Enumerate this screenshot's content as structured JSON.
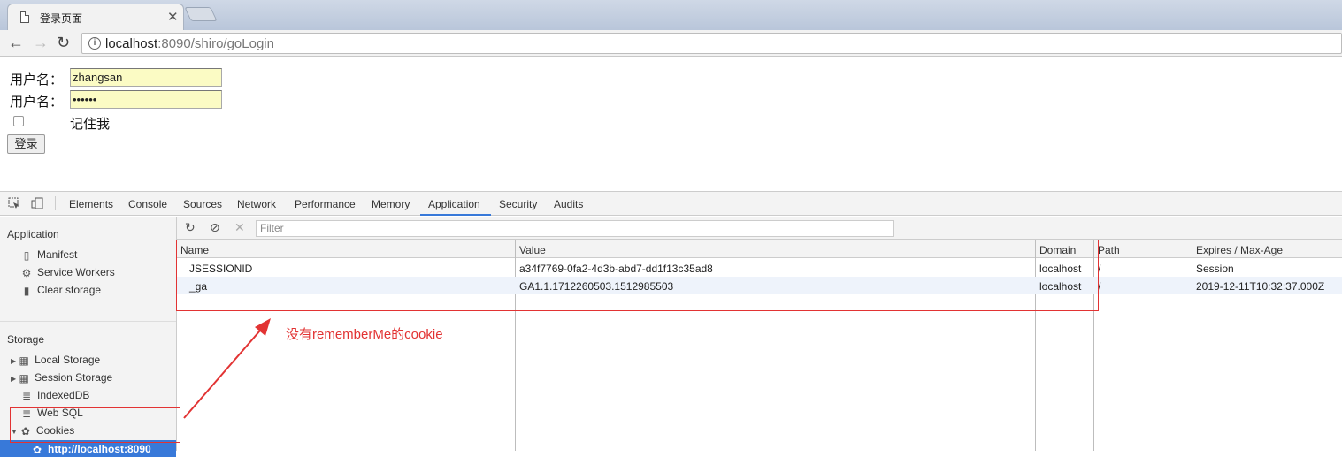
{
  "browser": {
    "tab_title": "登录页面",
    "url_host": "localhost",
    "url_rest": ":8090/shiro/goLogin"
  },
  "form": {
    "username_label": "用户名：",
    "username_value": "zhangsan",
    "password_label": "用户名：",
    "password_value": "••••••",
    "remember_label": "记住我",
    "login_button": "登录"
  },
  "devtools": {
    "tabs": [
      "Elements",
      "Console",
      "Sources",
      "Network",
      "Performance",
      "Memory",
      "Application",
      "Security",
      "Audits"
    ],
    "active_tab": "Application",
    "filter_placeholder": "Filter",
    "sidebar": {
      "application_header": "Application",
      "application_items": [
        "Manifest",
        "Service Workers",
        "Clear storage"
      ],
      "storage_header": "Storage",
      "storage_items": [
        "Local Storage",
        "Session Storage",
        "IndexedDB",
        "Web SQL",
        "Cookies",
        "http://localhost:8090"
      ]
    },
    "columns": [
      "Name",
      "Value",
      "Domain",
      "Path",
      "Expires / Max-Age"
    ],
    "rows": [
      {
        "name": "JSESSIONID",
        "value": "a34f7769-0fa2-4d3b-abd7-dd1f13c35ad8",
        "domain": "localhost",
        "path": "/",
        "expires": "Session"
      },
      {
        "name": "_ga",
        "value": "GA1.1.1712260503.1512985503",
        "domain": "localhost",
        "path": "/",
        "expires": "2019-12-11T10:32:37.000Z"
      }
    ]
  },
  "annotation": {
    "text": "没有rememberMe的cookie",
    "color": "#e23333"
  },
  "colors": {
    "accent": "#3879d9",
    "autofill": "#fbfbc4"
  }
}
